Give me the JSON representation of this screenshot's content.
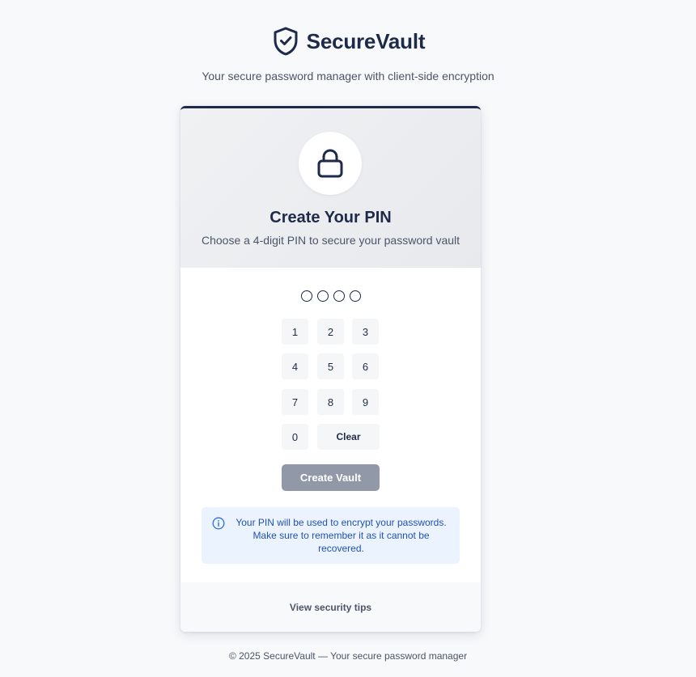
{
  "brand": {
    "name": "SecureVault",
    "tagline": "Your secure password manager with client-side encryption",
    "logo_icon": "shield-check-icon"
  },
  "card": {
    "header_icon": "lock-icon",
    "title": "Create Your PIN",
    "subtitle": "Choose a 4-digit PIN to secure your password vault",
    "pin": {
      "length": 4,
      "filled": 0
    },
    "keypad": {
      "keys": [
        "1",
        "2",
        "3",
        "4",
        "5",
        "6",
        "7",
        "8",
        "9",
        "0"
      ],
      "clear_label": "Clear"
    },
    "create_button_label": "Create Vault",
    "info": {
      "icon": "info-circle-icon",
      "text": "Your PIN will be used to encrypt your passwords. Make sure to remember it as it cannot be recovered."
    },
    "footer_link": "View security tips"
  },
  "footer": {
    "copyright": "© 2025 SecureVault — Your secure password manager"
  },
  "colors": {
    "primary": "#1e2a4a",
    "button_disabled": "#9199a8",
    "info_background": "#ebf3fe",
    "info_text": "#2451b5"
  }
}
